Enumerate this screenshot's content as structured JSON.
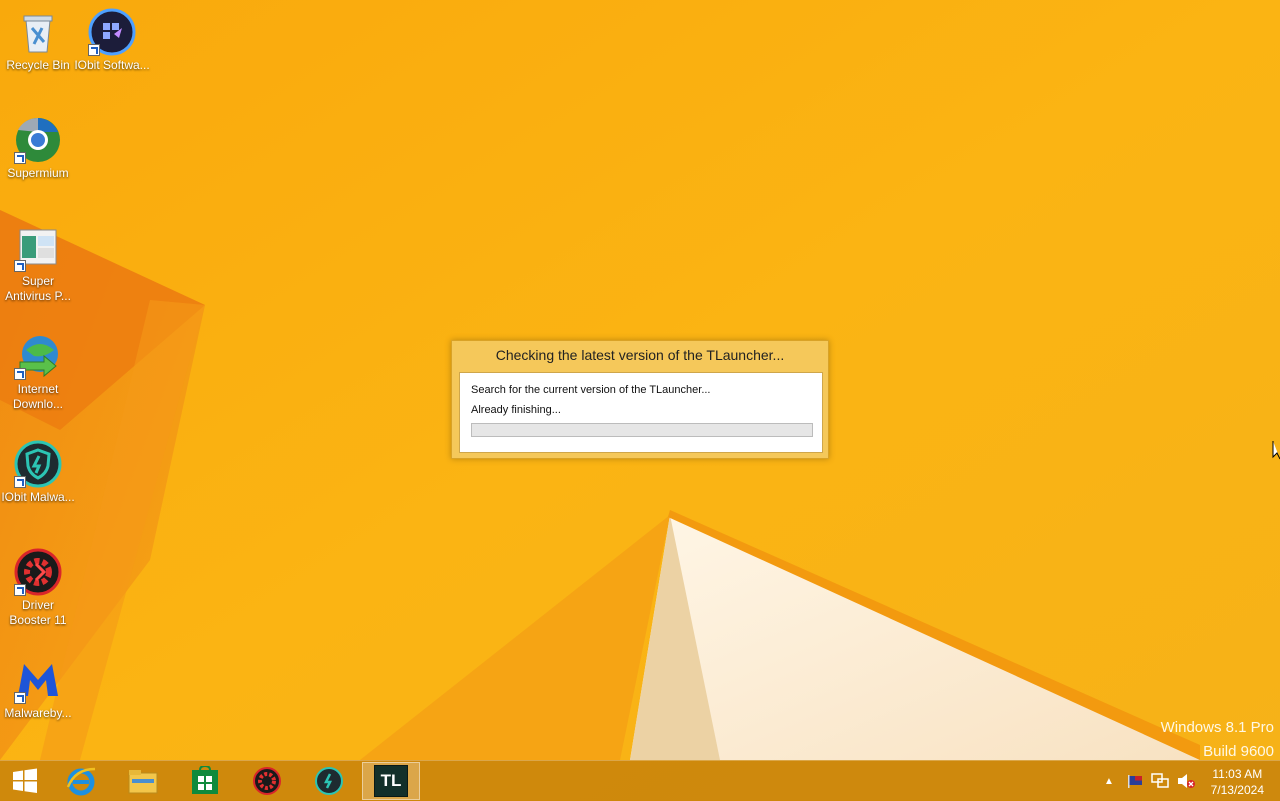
{
  "desktop": {
    "icons": [
      {
        "label": "Recycle Bin",
        "icon": "recycle-bin-icon"
      },
      {
        "label": "IObit Softwa...",
        "icon": "iobit-software-updater-icon"
      },
      {
        "label": "Supermium",
        "icon": "supermium-browser-icon"
      },
      {
        "label": "Super Antivirus P...",
        "icon": "super-antivirus-icon"
      },
      {
        "label": "Internet Downlo...",
        "icon": "internet-download-manager-icon"
      },
      {
        "label": "IObit Malwa...",
        "icon": "iobit-malware-fighter-icon"
      },
      {
        "label": "Driver Booster 11",
        "icon": "driver-booster-icon"
      },
      {
        "label": "Malwareby...",
        "icon": "malwarebytes-icon"
      }
    ]
  },
  "dialog": {
    "title": "Checking the latest version of the TLauncher...",
    "line1": "Search for the current version of the TLauncher...",
    "line2": "Already finishing...",
    "progress": 0
  },
  "watermark": {
    "line1": "Windows 8.1 Pro",
    "line2": "Build 9600"
  },
  "taskbar": {
    "items": [
      {
        "icon": "start-windows-icon"
      },
      {
        "icon": "internet-explorer-icon"
      },
      {
        "icon": "file-explorer-icon"
      },
      {
        "icon": "windows-store-icon"
      },
      {
        "icon": "driver-booster-icon"
      },
      {
        "icon": "iobit-malware-fighter-icon"
      },
      {
        "icon": "tlauncher-icon",
        "label": "TL",
        "active": true
      }
    ],
    "tray": {
      "icons": [
        "show-hidden-icons-chevron",
        "flag-icon",
        "network-icon",
        "volume-muted-icon"
      ],
      "time": "11:03 AM",
      "date": "7/13/2024"
    }
  },
  "colors": {
    "wallpaper": "#f7ad0b",
    "dialog_frame": "#f5c85a",
    "taskbar": "#be780a"
  }
}
